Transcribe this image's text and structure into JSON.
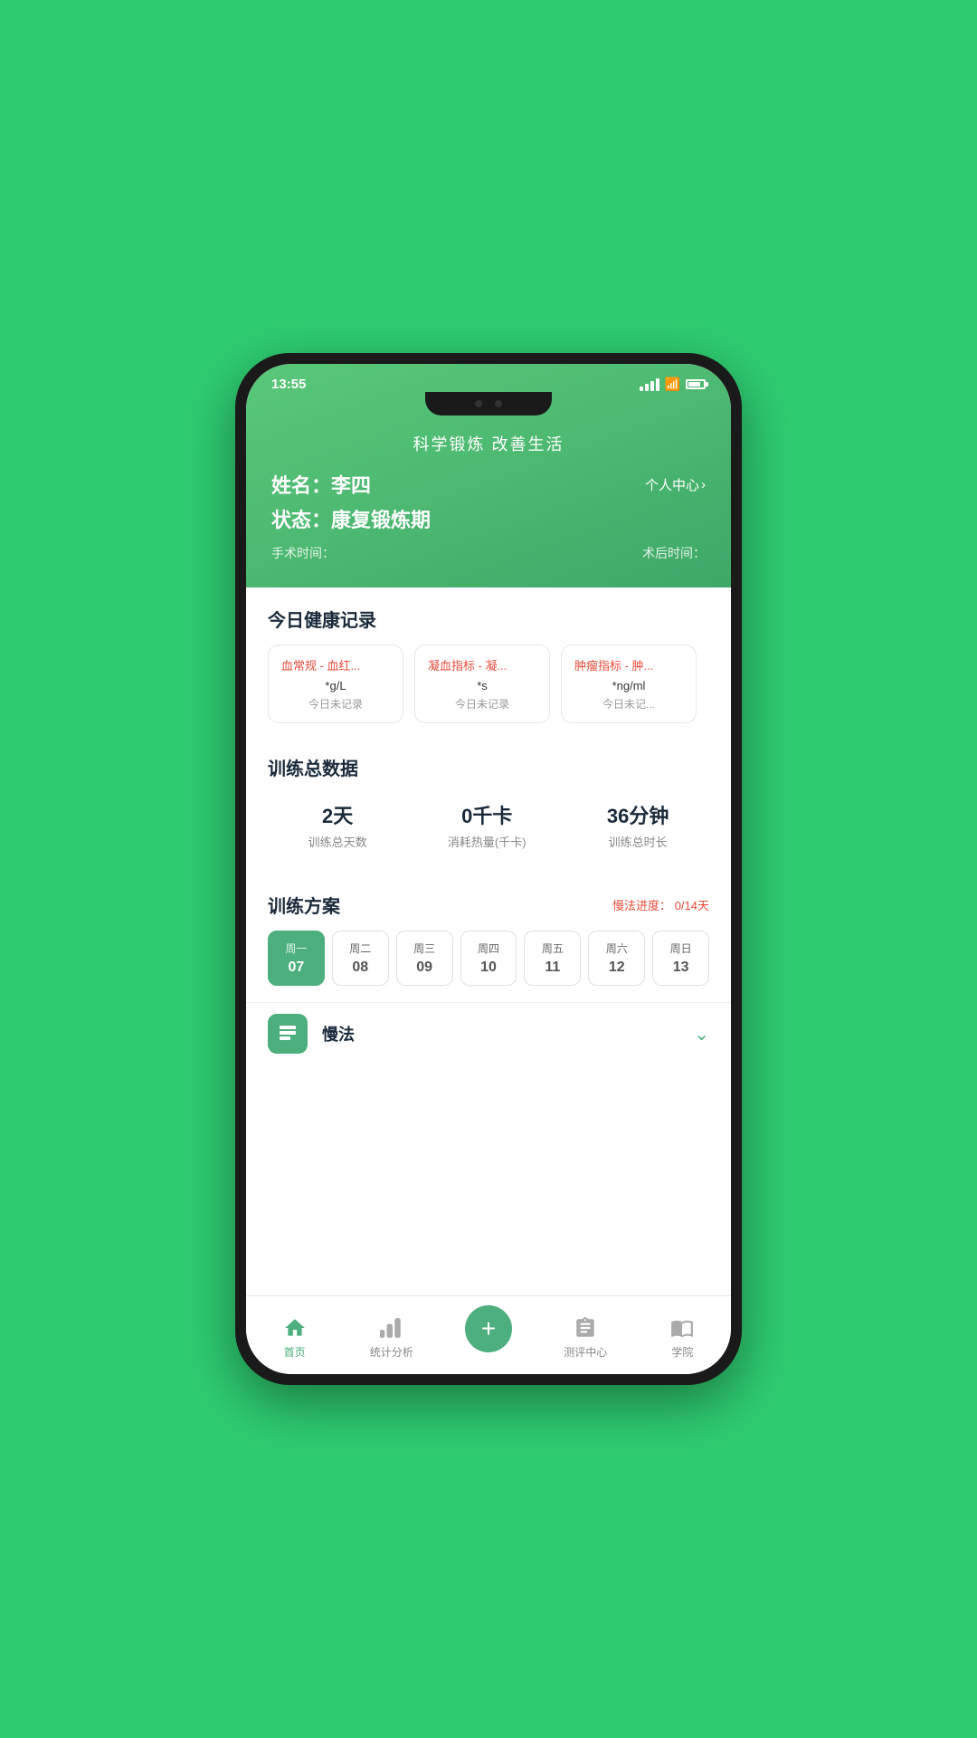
{
  "statusBar": {
    "time": "13:55"
  },
  "header": {
    "appTitle": "科学锻炼  改善生活",
    "userName": "姓名：李四",
    "personalCenter": "个人中心",
    "userStatus": "状态：康复锻炼期",
    "surgeryTime": "手术时间：",
    "postSurgeryTime": "术后时间："
  },
  "healthRecords": {
    "sectionTitle": "今日健康记录",
    "cards": [
      {
        "title": "血常规 - 血红...",
        "unit": "*g/L",
        "status": "今日未记录"
      },
      {
        "title": "凝血指标 - 凝...",
        "unit": "*s",
        "status": "今日未记录"
      },
      {
        "title": "肿瘤指标 - 肿...",
        "unit": "*ng/ml",
        "status": "今日未记..."
      }
    ]
  },
  "trainStats": {
    "sectionTitle": "训练总数据",
    "items": [
      {
        "value": "2天",
        "label": "训练总天数"
      },
      {
        "value": "0千卡",
        "label": "消耗热量(千卡)"
      },
      {
        "value": "36分钟",
        "label": "训练总时长"
      }
    ]
  },
  "trainPlan": {
    "sectionTitle": "训练方案",
    "progressLabel": "慢法进度：",
    "progressValue": "0/14天",
    "weekDays": [
      {
        "name": "周一",
        "num": "07",
        "active": true
      },
      {
        "name": "周二",
        "num": "08",
        "active": false
      },
      {
        "name": "周三",
        "num": "09",
        "active": false
      },
      {
        "name": "周四",
        "num": "10",
        "active": false
      },
      {
        "name": "周五",
        "num": "11",
        "active": false
      },
      {
        "name": "周六",
        "num": "12",
        "active": false
      },
      {
        "name": "周日",
        "num": "13",
        "active": false
      }
    ]
  },
  "manfa": {
    "label": "慢法"
  },
  "bottomNav": {
    "items": [
      {
        "label": "首页",
        "active": true,
        "icon": "home"
      },
      {
        "label": "统计分析",
        "active": false,
        "icon": "chart"
      },
      {
        "label": "",
        "active": false,
        "icon": "add"
      },
      {
        "label": "测评中心",
        "active": false,
        "icon": "clipboard"
      },
      {
        "label": "学院",
        "active": false,
        "icon": "book"
      }
    ]
  }
}
